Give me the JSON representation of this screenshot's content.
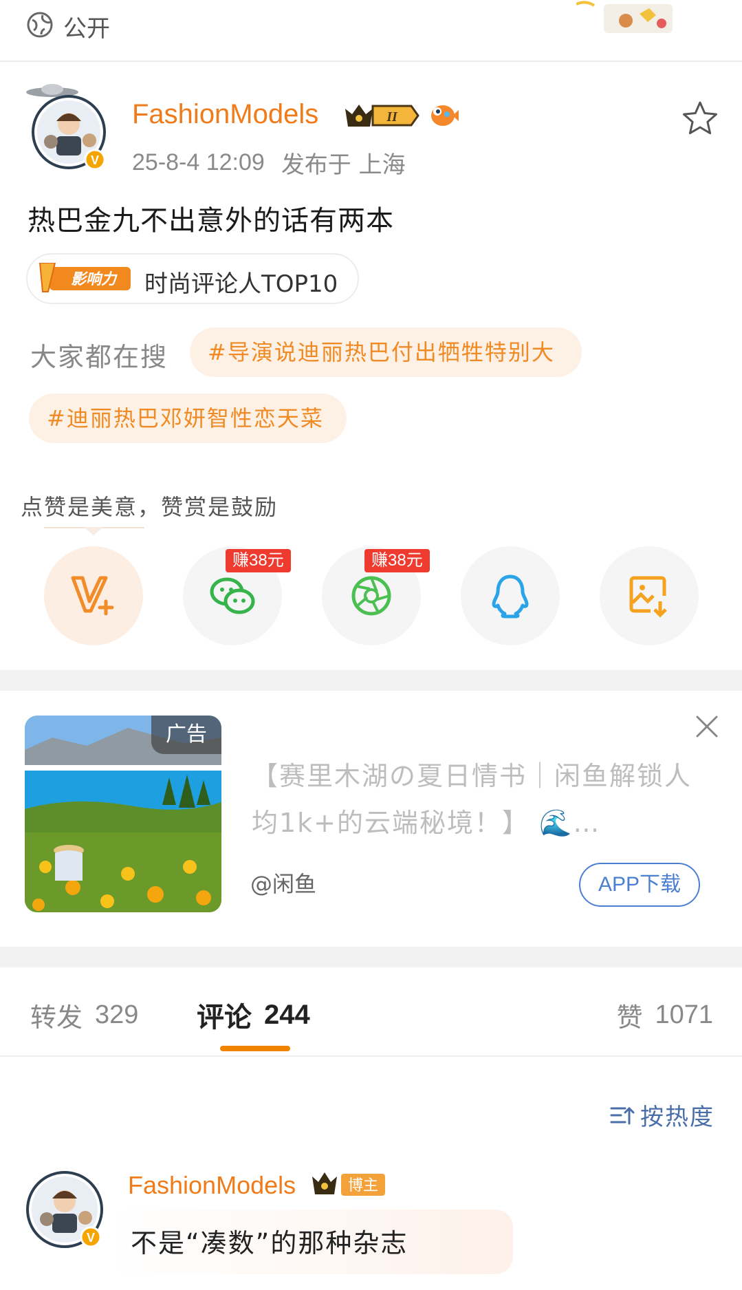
{
  "top_bar": {
    "privacy": "公开"
  },
  "post": {
    "author": "FashionModels",
    "level_badge": "II",
    "time": "25-8-4 12:09",
    "location": "发布于 上海",
    "text": "热巴金九不出意外的话有两本",
    "influence_badge": "影响力",
    "influence_rank": "时尚评论人TOP10"
  },
  "trending": {
    "label": "大家都在搜",
    "hashtags": [
      "#导演说迪丽热巴付出牺牲特别大",
      "#迪丽热巴邓妍智性恋天菜"
    ]
  },
  "reward": {
    "hint": "点赞是美意，赞赏是鼓励",
    "earn_wechat": "赚38元",
    "earn_moments": "赚38元"
  },
  "ad": {
    "label": "广告",
    "title": "【赛里木湖の夏日情书｜闲鱼解锁人均1k+的云端秘境！】 🌊…",
    "source": "@闲鱼",
    "download": "APP下载"
  },
  "tabs": {
    "repost_label": "转发",
    "repost_count": "329",
    "comment_label": "评论",
    "comment_count": "244",
    "like_label": "赞",
    "like_count": "1071"
  },
  "sort": {
    "label": "按热度"
  },
  "comment": {
    "author": "FashionModels",
    "role_badge": "博主",
    "text": "不是“凑数”的那种杂志"
  },
  "colors": {
    "accent_orange": "#f07b1a",
    "hashtag_bg": "#fdf0e4",
    "earn_red": "#ef3a2f",
    "link_blue": "#4a7fd2"
  }
}
